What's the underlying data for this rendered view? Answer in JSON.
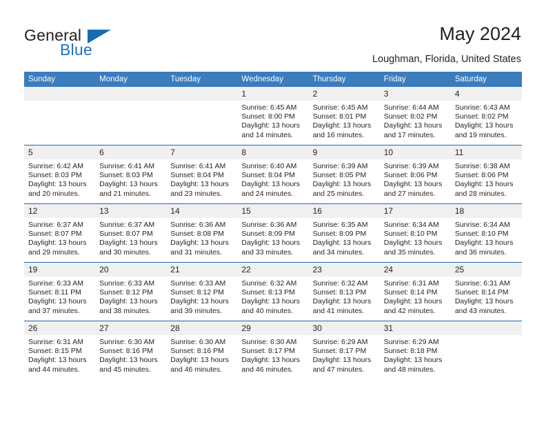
{
  "logo": {
    "word_top": "General",
    "word_bottom": "Blue",
    "triangle_color": "#176cb4",
    "blue_color": "#1f72c1"
  },
  "header": {
    "title": "May 2024",
    "subtitle": "Loughman, Florida, United States",
    "header_bg": "#3b7cbd",
    "row_divider": "#1d66ab",
    "daynum_bg": "#f0f0f0"
  },
  "weekday_headers": [
    "Sunday",
    "Monday",
    "Tuesday",
    "Wednesday",
    "Thursday",
    "Friday",
    "Saturday"
  ],
  "weeks": [
    [
      {
        "day": "",
        "empty": true
      },
      {
        "day": "",
        "empty": true
      },
      {
        "day": "",
        "empty": true
      },
      {
        "day": "1",
        "sunrise": "Sunrise: 6:45 AM",
        "sunset": "Sunset: 8:00 PM",
        "daylight_line1": "Daylight: 13 hours",
        "daylight_line2": "and 14 minutes."
      },
      {
        "day": "2",
        "sunrise": "Sunrise: 6:45 AM",
        "sunset": "Sunset: 8:01 PM",
        "daylight_line1": "Daylight: 13 hours",
        "daylight_line2": "and 16 minutes."
      },
      {
        "day": "3",
        "sunrise": "Sunrise: 6:44 AM",
        "sunset": "Sunset: 8:02 PM",
        "daylight_line1": "Daylight: 13 hours",
        "daylight_line2": "and 17 minutes."
      },
      {
        "day": "4",
        "sunrise": "Sunrise: 6:43 AM",
        "sunset": "Sunset: 8:02 PM",
        "daylight_line1": "Daylight: 13 hours",
        "daylight_line2": "and 19 minutes."
      }
    ],
    [
      {
        "day": "5",
        "sunrise": "Sunrise: 6:42 AM",
        "sunset": "Sunset: 8:03 PM",
        "daylight_line1": "Daylight: 13 hours",
        "daylight_line2": "and 20 minutes."
      },
      {
        "day": "6",
        "sunrise": "Sunrise: 6:41 AM",
        "sunset": "Sunset: 8:03 PM",
        "daylight_line1": "Daylight: 13 hours",
        "daylight_line2": "and 21 minutes."
      },
      {
        "day": "7",
        "sunrise": "Sunrise: 6:41 AM",
        "sunset": "Sunset: 8:04 PM",
        "daylight_line1": "Daylight: 13 hours",
        "daylight_line2": "and 23 minutes."
      },
      {
        "day": "8",
        "sunrise": "Sunrise: 6:40 AM",
        "sunset": "Sunset: 8:04 PM",
        "daylight_line1": "Daylight: 13 hours",
        "daylight_line2": "and 24 minutes."
      },
      {
        "day": "9",
        "sunrise": "Sunrise: 6:39 AM",
        "sunset": "Sunset: 8:05 PM",
        "daylight_line1": "Daylight: 13 hours",
        "daylight_line2": "and 25 minutes."
      },
      {
        "day": "10",
        "sunrise": "Sunrise: 6:39 AM",
        "sunset": "Sunset: 8:06 PM",
        "daylight_line1": "Daylight: 13 hours",
        "daylight_line2": "and 27 minutes."
      },
      {
        "day": "11",
        "sunrise": "Sunrise: 6:38 AM",
        "sunset": "Sunset: 8:06 PM",
        "daylight_line1": "Daylight: 13 hours",
        "daylight_line2": "and 28 minutes."
      }
    ],
    [
      {
        "day": "12",
        "sunrise": "Sunrise: 6:37 AM",
        "sunset": "Sunset: 8:07 PM",
        "daylight_line1": "Daylight: 13 hours",
        "daylight_line2": "and 29 minutes."
      },
      {
        "day": "13",
        "sunrise": "Sunrise: 6:37 AM",
        "sunset": "Sunset: 8:07 PM",
        "daylight_line1": "Daylight: 13 hours",
        "daylight_line2": "and 30 minutes."
      },
      {
        "day": "14",
        "sunrise": "Sunrise: 6:36 AM",
        "sunset": "Sunset: 8:08 PM",
        "daylight_line1": "Daylight: 13 hours",
        "daylight_line2": "and 31 minutes."
      },
      {
        "day": "15",
        "sunrise": "Sunrise: 6:36 AM",
        "sunset": "Sunset: 8:09 PM",
        "daylight_line1": "Daylight: 13 hours",
        "daylight_line2": "and 33 minutes."
      },
      {
        "day": "16",
        "sunrise": "Sunrise: 6:35 AM",
        "sunset": "Sunset: 8:09 PM",
        "daylight_line1": "Daylight: 13 hours",
        "daylight_line2": "and 34 minutes."
      },
      {
        "day": "17",
        "sunrise": "Sunrise: 6:34 AM",
        "sunset": "Sunset: 8:10 PM",
        "daylight_line1": "Daylight: 13 hours",
        "daylight_line2": "and 35 minutes."
      },
      {
        "day": "18",
        "sunrise": "Sunrise: 6:34 AM",
        "sunset": "Sunset: 8:10 PM",
        "daylight_line1": "Daylight: 13 hours",
        "daylight_line2": "and 36 minutes."
      }
    ],
    [
      {
        "day": "19",
        "sunrise": "Sunrise: 6:33 AM",
        "sunset": "Sunset: 8:11 PM",
        "daylight_line1": "Daylight: 13 hours",
        "daylight_line2": "and 37 minutes."
      },
      {
        "day": "20",
        "sunrise": "Sunrise: 6:33 AM",
        "sunset": "Sunset: 8:12 PM",
        "daylight_line1": "Daylight: 13 hours",
        "daylight_line2": "and 38 minutes."
      },
      {
        "day": "21",
        "sunrise": "Sunrise: 6:33 AM",
        "sunset": "Sunset: 8:12 PM",
        "daylight_line1": "Daylight: 13 hours",
        "daylight_line2": "and 39 minutes."
      },
      {
        "day": "22",
        "sunrise": "Sunrise: 6:32 AM",
        "sunset": "Sunset: 8:13 PM",
        "daylight_line1": "Daylight: 13 hours",
        "daylight_line2": "and 40 minutes."
      },
      {
        "day": "23",
        "sunrise": "Sunrise: 6:32 AM",
        "sunset": "Sunset: 8:13 PM",
        "daylight_line1": "Daylight: 13 hours",
        "daylight_line2": "and 41 minutes."
      },
      {
        "day": "24",
        "sunrise": "Sunrise: 6:31 AM",
        "sunset": "Sunset: 8:14 PM",
        "daylight_line1": "Daylight: 13 hours",
        "daylight_line2": "and 42 minutes."
      },
      {
        "day": "25",
        "sunrise": "Sunrise: 6:31 AM",
        "sunset": "Sunset: 8:14 PM",
        "daylight_line1": "Daylight: 13 hours",
        "daylight_line2": "and 43 minutes."
      }
    ],
    [
      {
        "day": "26",
        "sunrise": "Sunrise: 6:31 AM",
        "sunset": "Sunset: 8:15 PM",
        "daylight_line1": "Daylight: 13 hours",
        "daylight_line2": "and 44 minutes."
      },
      {
        "day": "27",
        "sunrise": "Sunrise: 6:30 AM",
        "sunset": "Sunset: 8:16 PM",
        "daylight_line1": "Daylight: 13 hours",
        "daylight_line2": "and 45 minutes."
      },
      {
        "day": "28",
        "sunrise": "Sunrise: 6:30 AM",
        "sunset": "Sunset: 8:16 PM",
        "daylight_line1": "Daylight: 13 hours",
        "daylight_line2": "and 46 minutes."
      },
      {
        "day": "29",
        "sunrise": "Sunrise: 6:30 AM",
        "sunset": "Sunset: 8:17 PM",
        "daylight_line1": "Daylight: 13 hours",
        "daylight_line2": "and 46 minutes."
      },
      {
        "day": "30",
        "sunrise": "Sunrise: 6:29 AM",
        "sunset": "Sunset: 8:17 PM",
        "daylight_line1": "Daylight: 13 hours",
        "daylight_line2": "and 47 minutes."
      },
      {
        "day": "31",
        "sunrise": "Sunrise: 6:29 AM",
        "sunset": "Sunset: 8:18 PM",
        "daylight_line1": "Daylight: 13 hours",
        "daylight_line2": "and 48 minutes."
      },
      {
        "day": "",
        "empty": true
      }
    ]
  ]
}
